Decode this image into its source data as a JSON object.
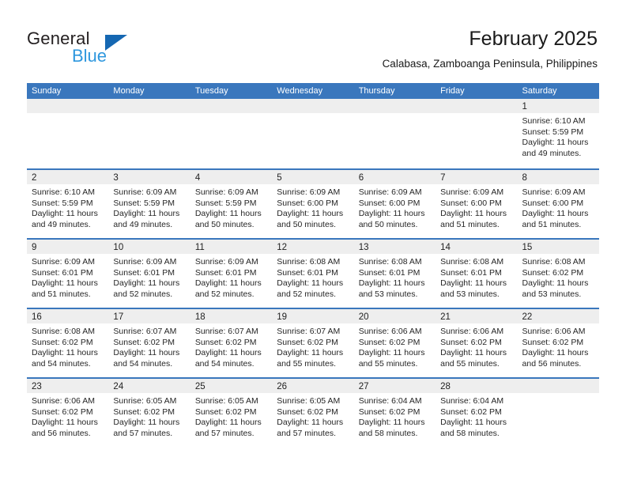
{
  "brand": {
    "name_part1": "General",
    "name_part2": "Blue",
    "logo_icon": "triangle-sail-icon"
  },
  "header": {
    "title": "February 2025",
    "location": "Calabasa, Zamboanga Peninsula, Philippines"
  },
  "colors": {
    "header_blue": "#3a77bd",
    "brand_blue": "#2e97de",
    "logo_blue": "#1567b2",
    "daynum_band": "#eeeeee",
    "text": "#262626"
  },
  "calendar": {
    "weekday_headers": [
      "Sunday",
      "Monday",
      "Tuesday",
      "Wednesday",
      "Thursday",
      "Friday",
      "Saturday"
    ],
    "labels": {
      "sunrise": "Sunrise:",
      "sunset": "Sunset:",
      "daylight": "Daylight:"
    },
    "weeks": [
      [
        {
          "day": "",
          "sunrise": "",
          "sunset": "",
          "daylight": ""
        },
        {
          "day": "",
          "sunrise": "",
          "sunset": "",
          "daylight": ""
        },
        {
          "day": "",
          "sunrise": "",
          "sunset": "",
          "daylight": ""
        },
        {
          "day": "",
          "sunrise": "",
          "sunset": "",
          "daylight": ""
        },
        {
          "day": "",
          "sunrise": "",
          "sunset": "",
          "daylight": ""
        },
        {
          "day": "",
          "sunrise": "",
          "sunset": "",
          "daylight": ""
        },
        {
          "day": "1",
          "sunrise": "Sunrise: 6:10 AM",
          "sunset": "Sunset: 5:59 PM",
          "daylight": "Daylight: 11 hours and 49 minutes."
        }
      ],
      [
        {
          "day": "2",
          "sunrise": "Sunrise: 6:10 AM",
          "sunset": "Sunset: 5:59 PM",
          "daylight": "Daylight: 11 hours and 49 minutes."
        },
        {
          "day": "3",
          "sunrise": "Sunrise: 6:09 AM",
          "sunset": "Sunset: 5:59 PM",
          "daylight": "Daylight: 11 hours and 49 minutes."
        },
        {
          "day": "4",
          "sunrise": "Sunrise: 6:09 AM",
          "sunset": "Sunset: 5:59 PM",
          "daylight": "Daylight: 11 hours and 50 minutes."
        },
        {
          "day": "5",
          "sunrise": "Sunrise: 6:09 AM",
          "sunset": "Sunset: 6:00 PM",
          "daylight": "Daylight: 11 hours and 50 minutes."
        },
        {
          "day": "6",
          "sunrise": "Sunrise: 6:09 AM",
          "sunset": "Sunset: 6:00 PM",
          "daylight": "Daylight: 11 hours and 50 minutes."
        },
        {
          "day": "7",
          "sunrise": "Sunrise: 6:09 AM",
          "sunset": "Sunset: 6:00 PM",
          "daylight": "Daylight: 11 hours and 51 minutes."
        },
        {
          "day": "8",
          "sunrise": "Sunrise: 6:09 AM",
          "sunset": "Sunset: 6:00 PM",
          "daylight": "Daylight: 11 hours and 51 minutes."
        }
      ],
      [
        {
          "day": "9",
          "sunrise": "Sunrise: 6:09 AM",
          "sunset": "Sunset: 6:01 PM",
          "daylight": "Daylight: 11 hours and 51 minutes."
        },
        {
          "day": "10",
          "sunrise": "Sunrise: 6:09 AM",
          "sunset": "Sunset: 6:01 PM",
          "daylight": "Daylight: 11 hours and 52 minutes."
        },
        {
          "day": "11",
          "sunrise": "Sunrise: 6:09 AM",
          "sunset": "Sunset: 6:01 PM",
          "daylight": "Daylight: 11 hours and 52 minutes."
        },
        {
          "day": "12",
          "sunrise": "Sunrise: 6:08 AM",
          "sunset": "Sunset: 6:01 PM",
          "daylight": "Daylight: 11 hours and 52 minutes."
        },
        {
          "day": "13",
          "sunrise": "Sunrise: 6:08 AM",
          "sunset": "Sunset: 6:01 PM",
          "daylight": "Daylight: 11 hours and 53 minutes."
        },
        {
          "day": "14",
          "sunrise": "Sunrise: 6:08 AM",
          "sunset": "Sunset: 6:01 PM",
          "daylight": "Daylight: 11 hours and 53 minutes."
        },
        {
          "day": "15",
          "sunrise": "Sunrise: 6:08 AM",
          "sunset": "Sunset: 6:02 PM",
          "daylight": "Daylight: 11 hours and 53 minutes."
        }
      ],
      [
        {
          "day": "16",
          "sunrise": "Sunrise: 6:08 AM",
          "sunset": "Sunset: 6:02 PM",
          "daylight": "Daylight: 11 hours and 54 minutes."
        },
        {
          "day": "17",
          "sunrise": "Sunrise: 6:07 AM",
          "sunset": "Sunset: 6:02 PM",
          "daylight": "Daylight: 11 hours and 54 minutes."
        },
        {
          "day": "18",
          "sunrise": "Sunrise: 6:07 AM",
          "sunset": "Sunset: 6:02 PM",
          "daylight": "Daylight: 11 hours and 54 minutes."
        },
        {
          "day": "19",
          "sunrise": "Sunrise: 6:07 AM",
          "sunset": "Sunset: 6:02 PM",
          "daylight": "Daylight: 11 hours and 55 minutes."
        },
        {
          "day": "20",
          "sunrise": "Sunrise: 6:06 AM",
          "sunset": "Sunset: 6:02 PM",
          "daylight": "Daylight: 11 hours and 55 minutes."
        },
        {
          "day": "21",
          "sunrise": "Sunrise: 6:06 AM",
          "sunset": "Sunset: 6:02 PM",
          "daylight": "Daylight: 11 hours and 55 minutes."
        },
        {
          "day": "22",
          "sunrise": "Sunrise: 6:06 AM",
          "sunset": "Sunset: 6:02 PM",
          "daylight": "Daylight: 11 hours and 56 minutes."
        }
      ],
      [
        {
          "day": "23",
          "sunrise": "Sunrise: 6:06 AM",
          "sunset": "Sunset: 6:02 PM",
          "daylight": "Daylight: 11 hours and 56 minutes."
        },
        {
          "day": "24",
          "sunrise": "Sunrise: 6:05 AM",
          "sunset": "Sunset: 6:02 PM",
          "daylight": "Daylight: 11 hours and 57 minutes."
        },
        {
          "day": "25",
          "sunrise": "Sunrise: 6:05 AM",
          "sunset": "Sunset: 6:02 PM",
          "daylight": "Daylight: 11 hours and 57 minutes."
        },
        {
          "day": "26",
          "sunrise": "Sunrise: 6:05 AM",
          "sunset": "Sunset: 6:02 PM",
          "daylight": "Daylight: 11 hours and 57 minutes."
        },
        {
          "day": "27",
          "sunrise": "Sunrise: 6:04 AM",
          "sunset": "Sunset: 6:02 PM",
          "daylight": "Daylight: 11 hours and 58 minutes."
        },
        {
          "day": "28",
          "sunrise": "Sunrise: 6:04 AM",
          "sunset": "Sunset: 6:02 PM",
          "daylight": "Daylight: 11 hours and 58 minutes."
        },
        {
          "day": "",
          "sunrise": "",
          "sunset": "",
          "daylight": ""
        }
      ]
    ]
  }
}
